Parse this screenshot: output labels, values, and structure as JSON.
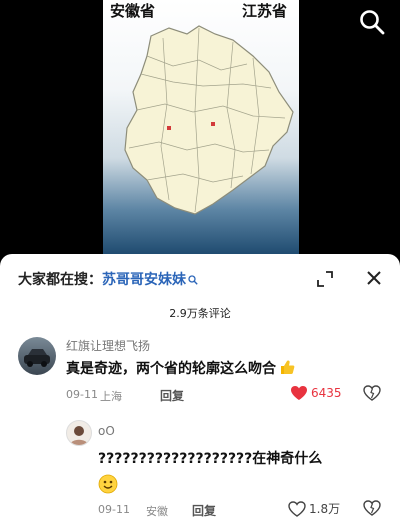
{
  "video": {
    "label_left": "安徽省",
    "label_right": "江苏省"
  },
  "sheet": {
    "search_prefix": "大家都在搜：",
    "search_term": "苏哥哥安妹妹",
    "comment_count": "2.9万条评论"
  },
  "comments": [
    {
      "username": "红旗让理想飞扬",
      "text": "真是奇迹，两个省的轮廓这么吻合",
      "date": "09-11",
      "location": "上海",
      "reply_label": "回复",
      "likes": "6435",
      "liked": true
    },
    {
      "username": "oO",
      "text": "???????????????????在神奇什么",
      "date": "09-11",
      "location": "安徽",
      "reply_label": "回复",
      "likes": "1.8万",
      "liked": false
    }
  ],
  "colors": {
    "like_active": "#e8333f",
    "search_term": "#2b65b8",
    "map_fill": "#f7f3d6"
  }
}
